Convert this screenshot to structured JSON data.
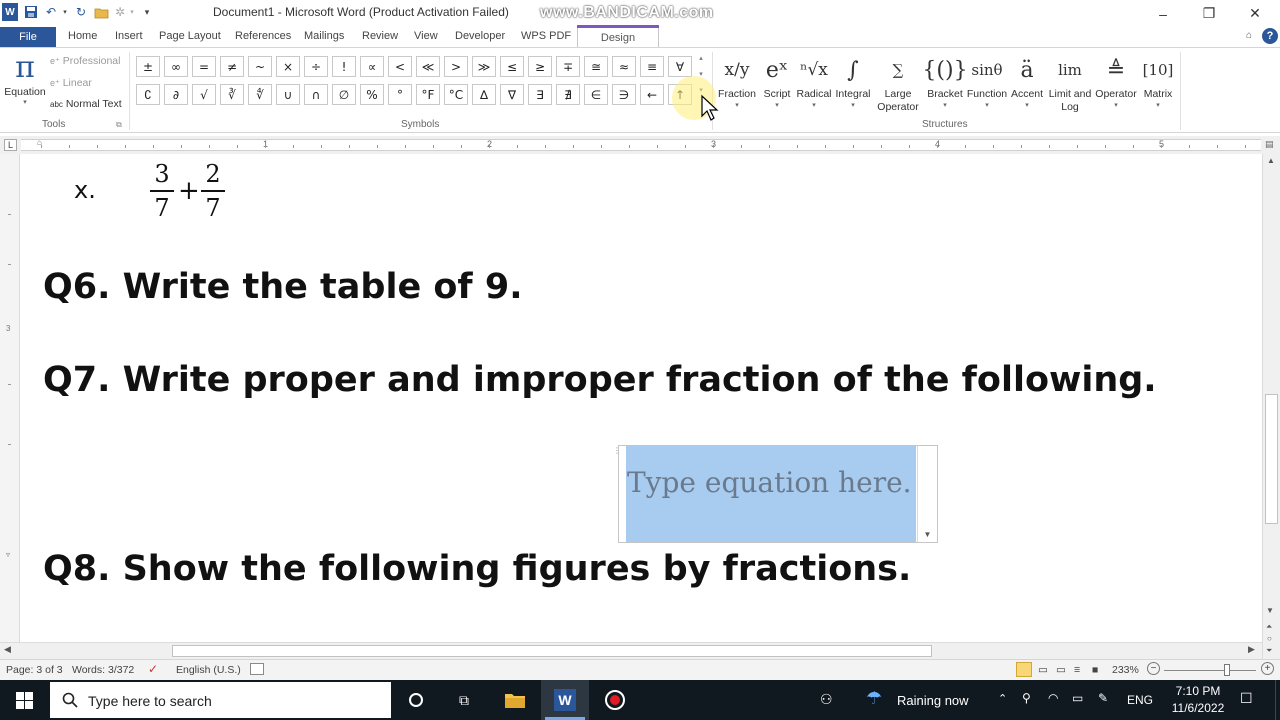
{
  "window": {
    "title": "Document1 - Microsoft Word (Product Activation Failed)",
    "watermark": "www.BANDICAM.com",
    "minimize": "–",
    "restore": "❐",
    "close": "✕"
  },
  "tabs": {
    "file": "File",
    "items": [
      "Home",
      "Insert",
      "Page Layout",
      "References",
      "Mailings",
      "Review",
      "View",
      "Developer",
      "WPS PDF"
    ],
    "design": "Design"
  },
  "tools": {
    "equation": "Equation",
    "professional": "Professional",
    "linear": "Linear",
    "normal_text": "Normal Text",
    "group_label": "Tools"
  },
  "symbols": {
    "row1": [
      "±",
      "∞",
      "=",
      "≠",
      "~",
      "×",
      "÷",
      "!",
      "∝",
      "<",
      "≪",
      ">",
      "≫",
      "≤",
      "≥",
      "∓",
      "≅",
      "≈",
      "≡",
      "∀"
    ],
    "row2": [
      "∁",
      "∂",
      "√",
      "∛",
      "∜",
      "∪",
      "∩",
      "∅",
      "%",
      "°",
      "°F",
      "°C",
      "∆",
      "∇",
      "∃",
      "∄",
      "∈",
      "∋",
      "←",
      "↑"
    ],
    "group_label": "Symbols"
  },
  "structures": {
    "items": [
      {
        "label": "Fraction",
        "glyph": "x/y"
      },
      {
        "label": "Script",
        "glyph": "eˣ"
      },
      {
        "label": "Radical",
        "glyph": "ⁿ√x"
      },
      {
        "label": "Integral",
        "glyph": "∫"
      },
      {
        "label": "Large\nOperator",
        "glyph": "∑"
      },
      {
        "label": "Bracket",
        "glyph": "{()}"
      },
      {
        "label": "Function",
        "glyph": "sinθ"
      },
      {
        "label": "Accent",
        "glyph": "ä"
      },
      {
        "label": "Limit and\nLog",
        "glyph": "lim"
      },
      {
        "label": "Operator",
        "glyph": "≜"
      },
      {
        "label": "Matrix",
        "glyph": "[10]"
      }
    ],
    "group_label": "Structures"
  },
  "ruler": {
    "numbers": [
      "1",
      "2",
      "3",
      "4",
      "5"
    ]
  },
  "document": {
    "item_x": "x.",
    "frac1_num": "3",
    "frac1_den": "7",
    "plus": "+",
    "frac2_num": "2",
    "frac2_den": "7",
    "q6": "Q6. Write the table of 9.",
    "q7": "Q7. Write proper and improper fraction of the following.",
    "q8": "Q8. Show the following figures by fractions.",
    "equation_placeholder": "Type equation here."
  },
  "status": {
    "page": "Page: 3 of 3",
    "words": "Words: 3/372",
    "language": "English (U.S.)",
    "zoom": "233%"
  },
  "taskbar": {
    "search_placeholder": "Type here to search",
    "weather": "Raining now",
    "lang": "ENG",
    "time": "7:10 PM",
    "date": "11/6/2022"
  },
  "colors": {
    "accent": "#2b579a",
    "design_accent": "#7e57c2",
    "selection": "#a8cbf0",
    "taskbar": "#101820"
  }
}
